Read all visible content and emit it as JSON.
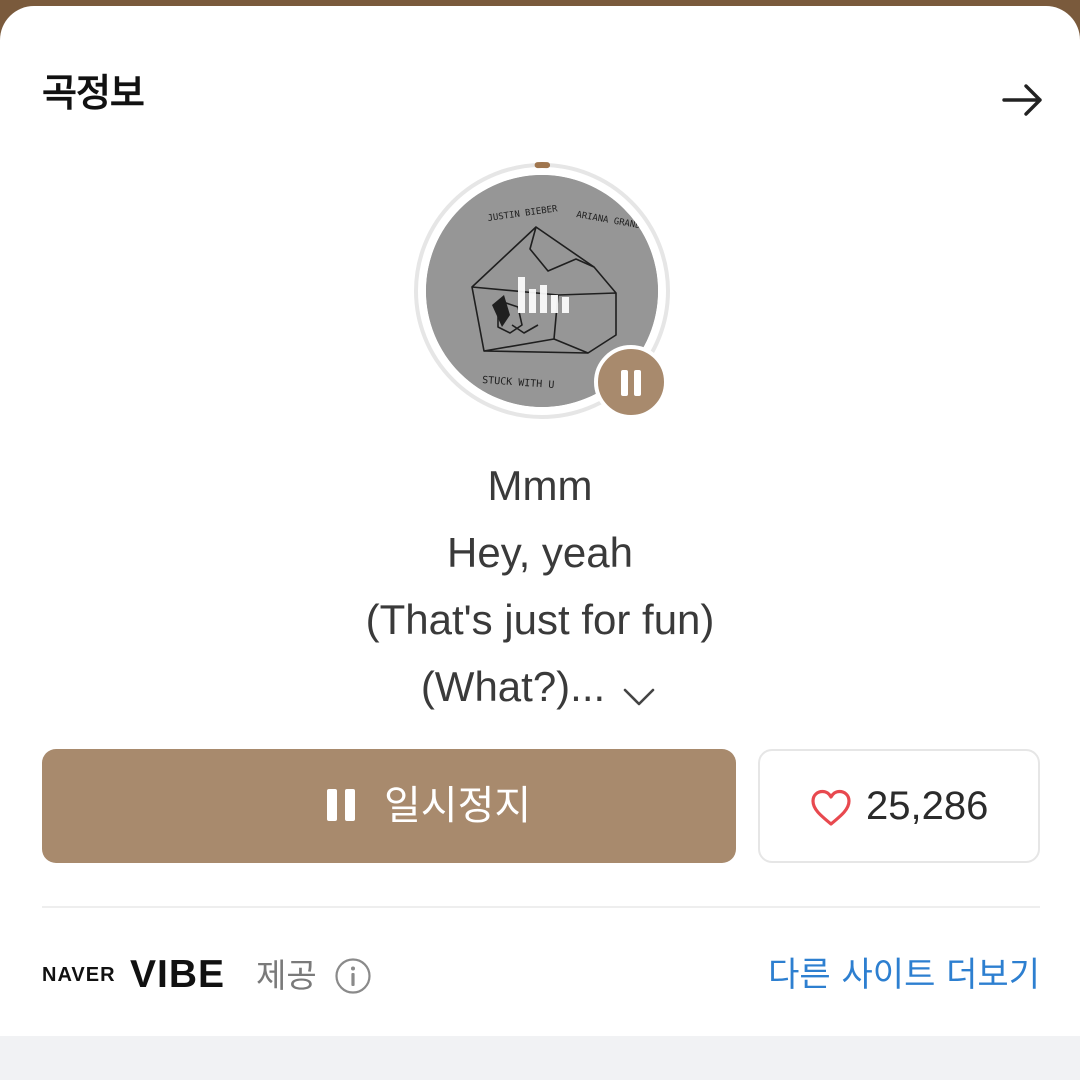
{
  "section": {
    "title": "곡정보"
  },
  "album": {
    "artist_left": "JUSTIN BIEBER",
    "artist_right": "ARIANA GRANDE",
    "cover_title": "STUCK WITH U"
  },
  "playback": {
    "progress": 0.01
  },
  "lyrics": {
    "lines": [
      "Mmm",
      "Hey, yeah",
      "(That's just for fun)",
      "(What?)..."
    ]
  },
  "actions": {
    "pause_label": "일시정지",
    "like_count": "25,286"
  },
  "footer": {
    "brand_small": "NAVER",
    "brand_large": "VIBE",
    "provide_label": "제공",
    "more_sites_label": "다른 사이트 더보기"
  },
  "colors": {
    "accent": "#a88a6d",
    "link": "#2d7fd0",
    "heart": "#e8494f"
  }
}
